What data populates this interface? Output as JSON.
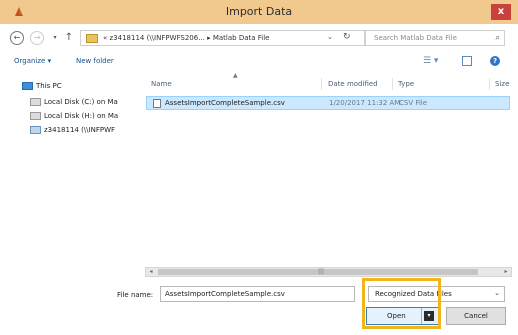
{
  "window": {
    "title": "Import Data",
    "close_symbol": "x",
    "accent_color": "#f1c98f",
    "highlight_color": "#f0b51c"
  },
  "nav": {
    "address_path": "« z3418114 (\\\\INFPWFS206...  ▸  Matlab Data File",
    "search_placeholder": "Search Matlab Data File"
  },
  "toolbar": {
    "organize_label": "Organize ▾",
    "new_folder_label": "New folder"
  },
  "sidebar": {
    "items": [
      {
        "label": "This PC",
        "icon": "computer-icon"
      },
      {
        "label": "Local Disk (C:) on Ma",
        "icon": "drive-icon"
      },
      {
        "label": "Local Disk (H:) on Ma",
        "icon": "drive-icon"
      },
      {
        "label": "z3418114 (\\\\INFPWF",
        "icon": "network-drive-icon"
      }
    ]
  },
  "file_list": {
    "columns": [
      "Name",
      "Date modified",
      "Type",
      "Size"
    ],
    "files": [
      {
        "name": "AssetsImportCompleteSample.csv",
        "date_modified": "1/20/2017 11:32 AM",
        "type": "CSV File"
      }
    ]
  },
  "footer": {
    "file_name_label": "File name:",
    "file_name_value": "AssetsImportCompleteSample.csv",
    "file_type_value": "Recognized Data Files",
    "open_label": "Open",
    "cancel_label": "Cancel"
  }
}
